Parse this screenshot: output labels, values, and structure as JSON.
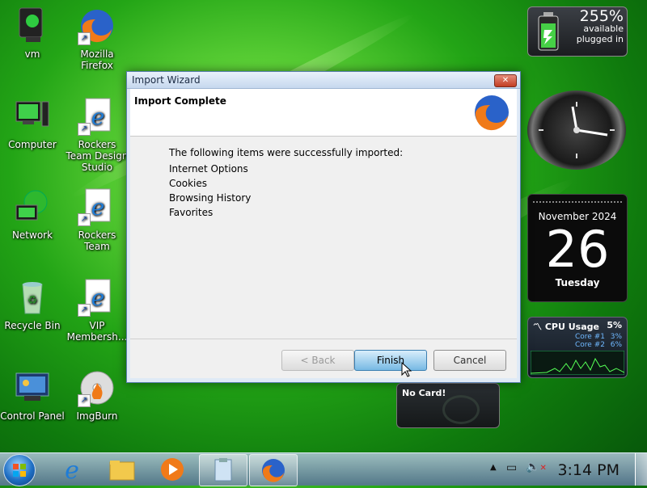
{
  "desktop": {
    "icons": [
      {
        "label": "vm",
        "icon": "monitor-person-icon"
      },
      {
        "label": "Mozilla Firefox",
        "icon": "firefox-icon"
      },
      {
        "label": "Computer",
        "icon": "computer-icon"
      },
      {
        "label": "Rockers Team Design Studio",
        "icon": "ie-document-icon"
      },
      {
        "label": "Network",
        "icon": "network-icon"
      },
      {
        "label": "Rockers Team",
        "icon": "ie-document-icon"
      },
      {
        "label": "Recycle Bin",
        "icon": "recycle-bin-icon"
      },
      {
        "label": "VIP Membersh...",
        "icon": "ie-document-icon"
      },
      {
        "label": "Control Panel",
        "icon": "control-panel-icon"
      },
      {
        "label": "ImgBurn",
        "icon": "imgburn-icon"
      }
    ]
  },
  "gadgets": {
    "battery": {
      "percent": "255%",
      "line1": "available",
      "line2": "plugged in"
    },
    "calendar": {
      "month_year": "November 2024",
      "day": "26",
      "weekday": "Tuesday"
    },
    "cpu": {
      "title": "CPU Usage",
      "total": "5%",
      "cores": [
        {
          "label": "Core #1",
          "value": "3%"
        },
        {
          "label": "Core #2",
          "value": "6%"
        }
      ]
    },
    "nocard": {
      "text": "No Card!"
    }
  },
  "dialog": {
    "title": "Import Wizard",
    "close_label": "✕",
    "header": "Import Complete",
    "lead": "The following items were successfully imported:",
    "items": [
      "Internet Options",
      "Cookies",
      "Browsing History",
      "Favorites"
    ],
    "buttons": {
      "back": "< Back",
      "finish": "Finish",
      "cancel": "Cancel"
    }
  },
  "taskbar": {
    "pinned": [
      "ie-icon",
      "explorer-folder-icon",
      "media-player-icon",
      "clipboard-icon",
      "firefox-icon"
    ],
    "time": "3:14 PM"
  },
  "colors": {
    "accent": "#2f74c0",
    "desktop_green": "#23a516"
  }
}
